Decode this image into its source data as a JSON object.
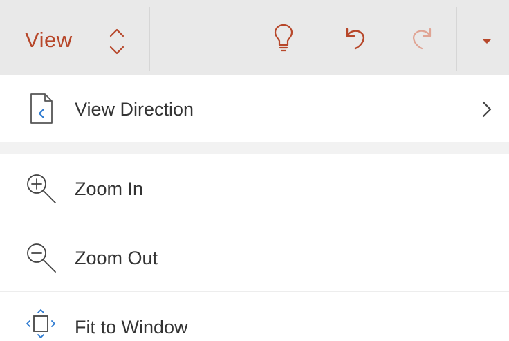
{
  "toolbar": {
    "view_label": "View",
    "icons": {
      "chevrons": "up-down-chevron-icon",
      "idea": "lightbulb-icon",
      "undo": "undo-icon",
      "redo": "redo-icon",
      "more": "dropdown-caret-icon"
    },
    "accent_color": "#b7472a",
    "disabled_color": "#e0a494"
  },
  "menu": {
    "items": [
      {
        "label": "View Direction",
        "icon": "document-direction-icon",
        "has_submenu": true
      },
      {
        "label": "Zoom In",
        "icon": "zoom-in-icon"
      },
      {
        "label": "Zoom Out",
        "icon": "zoom-out-icon"
      },
      {
        "label": "Fit to Window",
        "icon": "fit-to-window-icon"
      }
    ]
  }
}
